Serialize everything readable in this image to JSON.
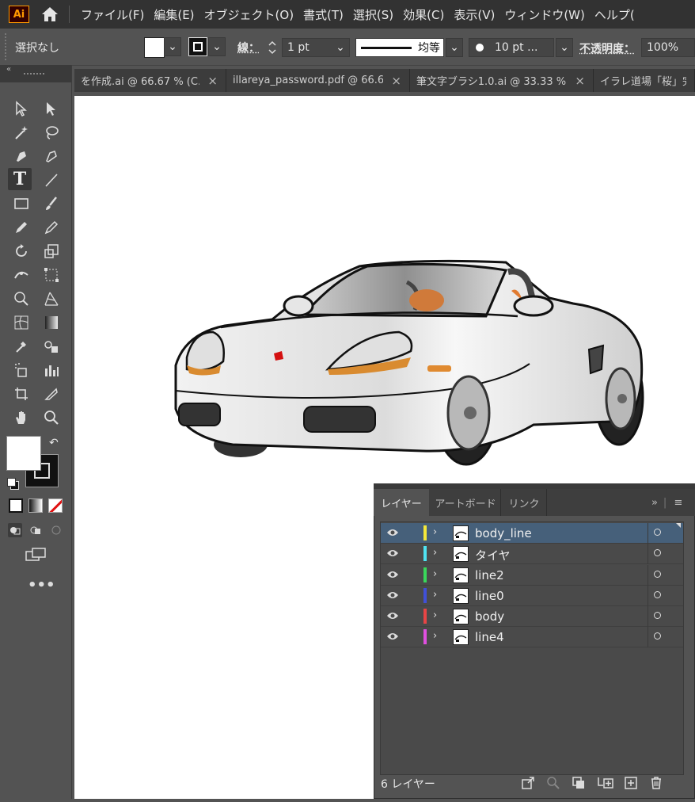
{
  "app": {
    "logo_text": "Ai",
    "menu": [
      "ファイル(F)",
      "編集(E)",
      "オブジェクト(O)",
      "書式(T)",
      "選択(S)",
      "効果(C)",
      "表示(V)",
      "ウィンドウ(W)",
      "ヘルプ("
    ]
  },
  "control": {
    "selection": "選択なし",
    "stroke_label": "線：",
    "stroke_weight": "1 pt",
    "stroke_profile": "均等",
    "brush": "10 pt ...",
    "opacity_label": "不透明度：",
    "opacity": "100%"
  },
  "tabs": [
    {
      "label": "を作成.ai @ 66.67 % (C...",
      "close": "×"
    },
    {
      "label": "illareya_password.pdf @ 66.6...",
      "close": "×"
    },
    {
      "label": "筆文字ブラシ1.0.ai @ 33.33 %...",
      "close": "×"
    },
    {
      "label": "イラレ道場「桜」完成",
      "close": ""
    }
  ],
  "layers_panel": {
    "tabs": [
      "レイヤー",
      "アートボード",
      "リンク"
    ],
    "layers": [
      {
        "name": "body_line",
        "color": "#f5e83a",
        "selected": true
      },
      {
        "name": "タイヤ",
        "color": "#4fe3f2",
        "selected": false
      },
      {
        "name": "line2",
        "color": "#39d85a",
        "selected": false
      },
      {
        "name": "line0",
        "color": "#4050d8",
        "selected": false
      },
      {
        "name": "body",
        "color": "#e84545",
        "selected": false
      },
      {
        "name": "line4",
        "color": "#e04fe0",
        "selected": false
      }
    ],
    "count": "6 レイヤー"
  },
  "colors": {
    "accent_logo": "#ff9a00",
    "selected_row": "#46607a"
  }
}
